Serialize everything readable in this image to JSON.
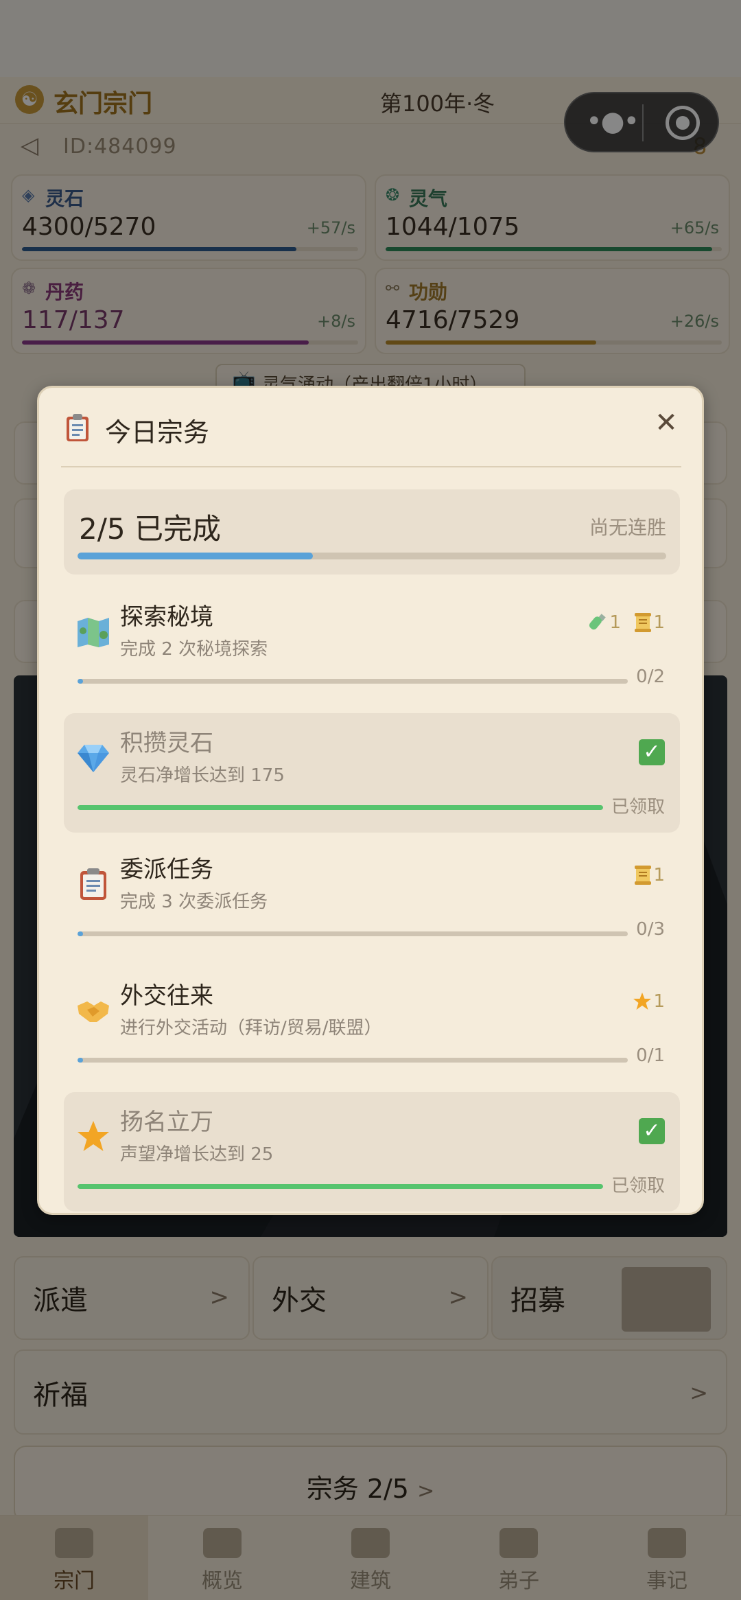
{
  "header": {
    "sect_name": "玄门宗门",
    "season": "第100年·冬",
    "user_id": "ID:484099",
    "badge_count": "8"
  },
  "resources": [
    {
      "name": "灵石",
      "value": "4300/5270",
      "rate": "+57/s",
      "progress": 0.816,
      "color": "#2e5b8f"
    },
    {
      "name": "灵气",
      "value": "1044/1075",
      "rate": "+65/s",
      "progress": 0.971,
      "color": "#2e8a5a"
    },
    {
      "name": "丹药",
      "value": "117/137",
      "rate": "+8/s",
      "progress": 0.854,
      "color": "#8a3a8a"
    },
    {
      "name": "功勋",
      "value": "4716/7529",
      "rate": "+26/s",
      "progress": 0.626,
      "color": "#b88a2a"
    }
  ],
  "boost": {
    "label": "灵气涌动（产出翻倍1小时）"
  },
  "actions": {
    "dispatch": "派遣",
    "diplomacy": "外交",
    "recruit": "招募",
    "pray": "祈福",
    "arrow": ">"
  },
  "duty_button": {
    "label": "宗务 2/5",
    "chevron": ">"
  },
  "tabs": [
    {
      "label": "宗门",
      "icon": "pagoda-icon",
      "active": true
    },
    {
      "label": "概览",
      "icon": "scroll-icon",
      "active": false
    },
    {
      "label": "建筑",
      "icon": "tools-icon",
      "active": false
    },
    {
      "label": "弟子",
      "icon": "disciple-icon",
      "active": false
    },
    {
      "label": "事记",
      "icon": "chronicle-icon",
      "active": false
    }
  ],
  "modal": {
    "title": "今日宗务",
    "close": "✕",
    "summary": {
      "completed": "2/5 已完成",
      "streak": "尚无连胜",
      "progress": 0.4
    },
    "tasks": [
      {
        "title": "探索秘境",
        "desc": "完成 2 次秘境探索",
        "icon": "map-icon",
        "progress_text": "0/2",
        "progress": 0.0,
        "claimed": false,
        "rewards": [
          {
            "icon": "potion-icon",
            "count": "1"
          },
          {
            "icon": "scroll-icon",
            "count": "1"
          }
        ]
      },
      {
        "title": "积攒灵石",
        "desc": "灵石净增长达到 175",
        "icon": "gem-icon",
        "progress_text": "已领取",
        "progress": 1.0,
        "claimed": true,
        "rewards": []
      },
      {
        "title": "委派任务",
        "desc": "完成 3 次委派任务",
        "icon": "clipboard-icon",
        "progress_text": "0/3",
        "progress": 0.0,
        "claimed": false,
        "rewards": [
          {
            "icon": "scroll-icon",
            "count": "1"
          }
        ]
      },
      {
        "title": "外交往来",
        "desc": "进行外交活动（拜访/贸易/联盟）",
        "icon": "handshake-icon",
        "progress_text": "0/1",
        "progress": 0.0,
        "claimed": false,
        "rewards": [
          {
            "icon": "star-icon",
            "count": "1"
          }
        ]
      },
      {
        "title": "扬名立万",
        "desc": "声望净增长达到 25",
        "icon": "star-icon",
        "progress_text": "已领取",
        "progress": 1.0,
        "claimed": true,
        "rewards": []
      }
    ]
  }
}
